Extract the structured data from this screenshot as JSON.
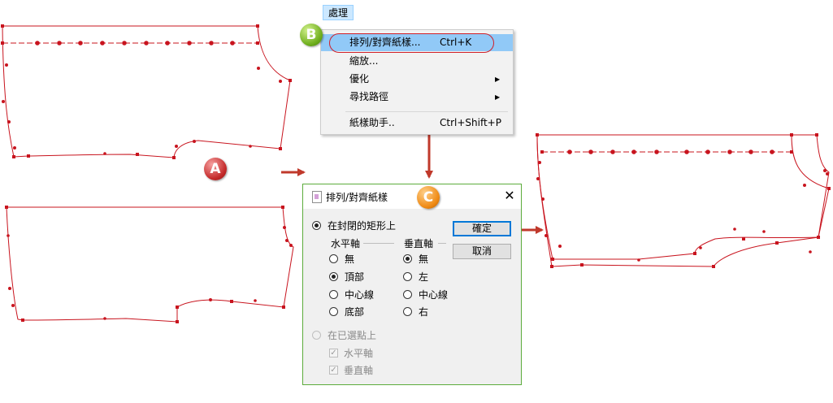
{
  "menu": {
    "title": "處理",
    "items": [
      {
        "label": "排列/對齊紙樣...",
        "shortcut": "Ctrl+K",
        "submenu": false,
        "highlighted": true
      },
      {
        "label": "縮放...",
        "shortcut": "",
        "submenu": false,
        "highlighted": false
      },
      {
        "label": "優化",
        "shortcut": "",
        "submenu": true,
        "highlighted": false
      },
      {
        "label": "尋找路徑",
        "shortcut": "",
        "submenu": true,
        "highlighted": false
      },
      {
        "label": "紙樣助手..",
        "shortcut": "Ctrl+Shift+P",
        "submenu": false,
        "highlighted": false
      }
    ],
    "submenu_glyph": "▶"
  },
  "badges": {
    "a": "A",
    "b": "B",
    "c": "C"
  },
  "dialog": {
    "title": "排列/對齊紙樣",
    "close_glyph": "✕",
    "option_rect": "在封閉的矩形上",
    "horizontal_group": "水平軸",
    "vertical_group": "垂直軸",
    "horizontal_options": [
      "無",
      "頂部",
      "中心線",
      "底部"
    ],
    "horizontal_selected": "頂部",
    "vertical_options": [
      "無",
      "左",
      "中心線",
      "右"
    ],
    "vertical_selected": "無",
    "option_points": "在已選點上",
    "check_horizontal": "水平軸",
    "check_vertical": "垂直軸",
    "ok": "確定",
    "cancel": "取消"
  },
  "colors": {
    "pattern_line": "#c8141e",
    "arrow": "#c0392b",
    "menu_highlight": "#91c9f7",
    "dialog_border": "#5cac3c",
    "default_button_border": "#0078d7"
  }
}
